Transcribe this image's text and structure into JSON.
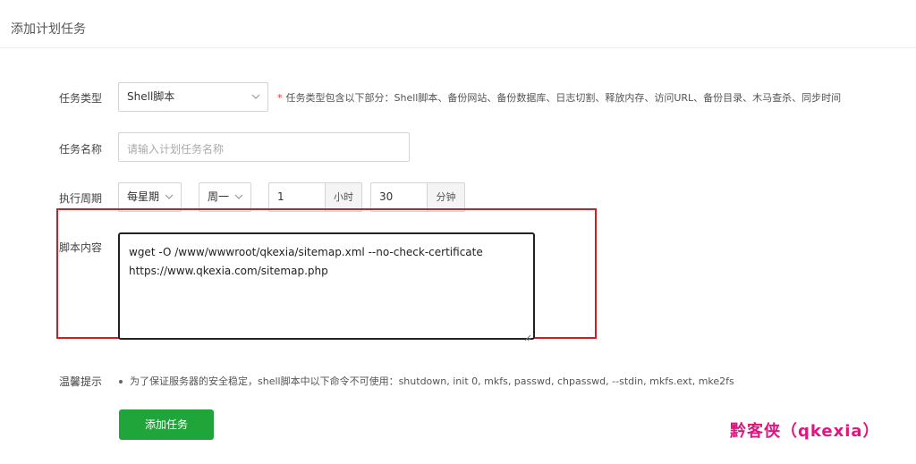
{
  "header": {
    "title": "添加计划任务"
  },
  "form": {
    "task_type": {
      "label": "任务类型",
      "value": "Shell脚本",
      "hint_star": "*",
      "hint": "任务类型包含以下部分：Shell脚本、备份网站、备份数据库、日志切割、释放内存、访问URL、备份目录、木马查杀、同步时间"
    },
    "task_name": {
      "label": "任务名称",
      "placeholder": "请输入计划任务名称",
      "value": ""
    },
    "period": {
      "label": "执行周期",
      "frequency": "每星期",
      "weekday": "周一",
      "hour": "1",
      "hour_unit": "小时",
      "minute": "30",
      "minute_unit": "分钟"
    },
    "script": {
      "label": "脚本内容",
      "line1": "wget -O /www/wwwroot/qkexia/sitemap.xml --no-check-certificate",
      "line2": "https://www.qkexia.com/sitemap.php"
    },
    "tips": {
      "label": "温馨提示",
      "text": "为了保证服务器的安全稳定，shell脚本中以下命令不可使用：shutdown, init 0, mkfs, passwd, chpasswd, --stdin, mkfs.ext, mke2fs"
    },
    "submit_label": "添加任务"
  },
  "watermark": "黔客侠（qkexia）",
  "colors": {
    "accent": "#20a53a",
    "highlight": "#cc1f24",
    "watermark": "#e0157f",
    "required": "#ee3333"
  },
  "icons": {
    "dropdown": "chevron-down-icon",
    "resize": "resize-grip-icon"
  }
}
